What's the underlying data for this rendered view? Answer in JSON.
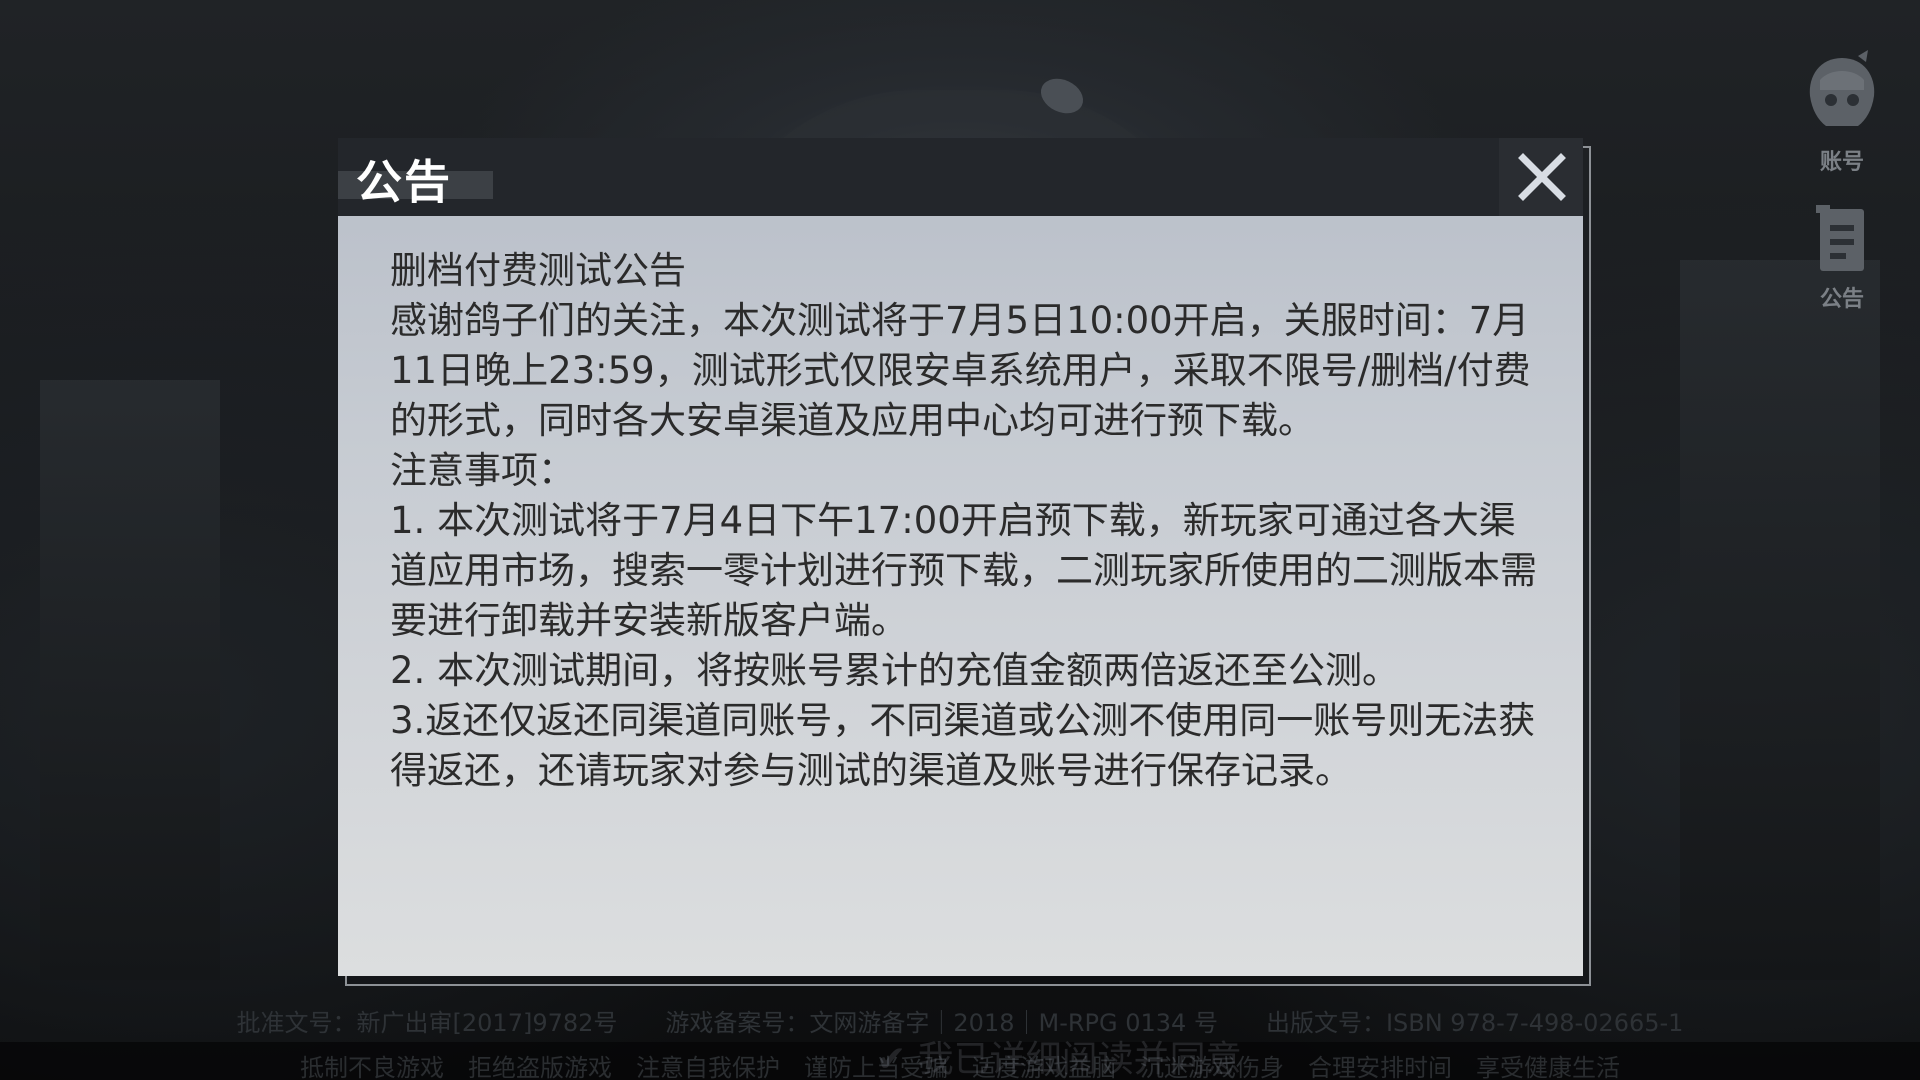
{
  "sidebar": {
    "account_label": "账号",
    "notice_label": "公告"
  },
  "dialog": {
    "title": "公告",
    "close_icon": "close-icon",
    "lines": [
      "删档付费测试公告",
      "感谢鸽子们的关注，本次测试将于7月5日10:00开启，关服时间：7月11日晚上23:59，测试形式仅限安卓系统用户，采取不限号/删档/付费的形式，同时各大安卓渠道及应用中心均可进行预下载。",
      "注意事项：",
      "1. 本次测试将于7月4日下午17:00开启预下载，新玩家可通过各大渠道应用市场，搜索一零计划进行预下载，二测玩家所使用的二测版本需要进行卸载并安装新版客户端。",
      "2. 本次测试期间，将按账号累计的充值金额两倍返还至公测。",
      "3.返还仅返还同渠道同账号，不同渠道或公测不使用同一账号则无法获得返还，还请玩家对参与测试的渠道及账号进行保存记录。"
    ]
  },
  "background": {
    "agreement_text": "我已详细阅读并同意",
    "approval_line": "批准文号：新广出审[2017]9782号　　游戏备案号：文网游备字｜2018｜M-RPG 0134 号　　出版文号：ISBN 978-7-498-02665-1",
    "health_notice": "抵制不良游戏　拒绝盗版游戏　注意自我保护　谨防上当受骗　适度游戏益脑　沉迷游戏伤身　合理安排时间　享受健康生活"
  },
  "colors": {
    "dialog_header": "#23262b",
    "dialog_body_top": "#b8bec8",
    "dialog_body_bottom": "#dcdedf",
    "text": "#2b2b2b"
  }
}
